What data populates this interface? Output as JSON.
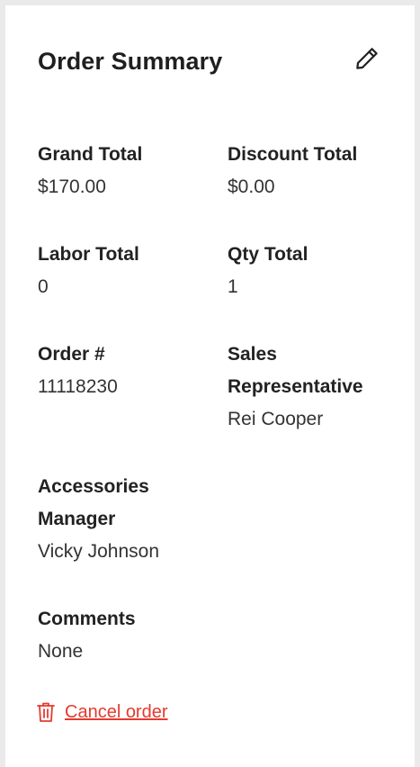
{
  "header": {
    "title": "Order Summary",
    "edit_icon": "pencil-icon"
  },
  "fields": {
    "grand_total": {
      "label": "Grand Total",
      "value": "$170.00"
    },
    "discount_total": {
      "label": "Discount Total",
      "value": "$0.00"
    },
    "labor_total": {
      "label": "Labor Total",
      "value": "0"
    },
    "qty_total": {
      "label": "Qty Total",
      "value": "1"
    },
    "order_number": {
      "label": "Order #",
      "value": "11118230"
    },
    "sales_rep": {
      "label_line1": "Sales",
      "label_line2": "Representative",
      "value": "Rei Cooper"
    },
    "accessories_manager": {
      "label_line1": "Accessories",
      "label_line2": "Manager",
      "value": "Vicky Johnson"
    },
    "comments": {
      "label": "Comments",
      "value": "None"
    }
  },
  "actions": {
    "cancel_label": "Cancel order",
    "cancel_icon": "trash-icon"
  },
  "colors": {
    "danger": "#e53a2f",
    "background": "#eaeaea",
    "card": "#ffffff"
  }
}
